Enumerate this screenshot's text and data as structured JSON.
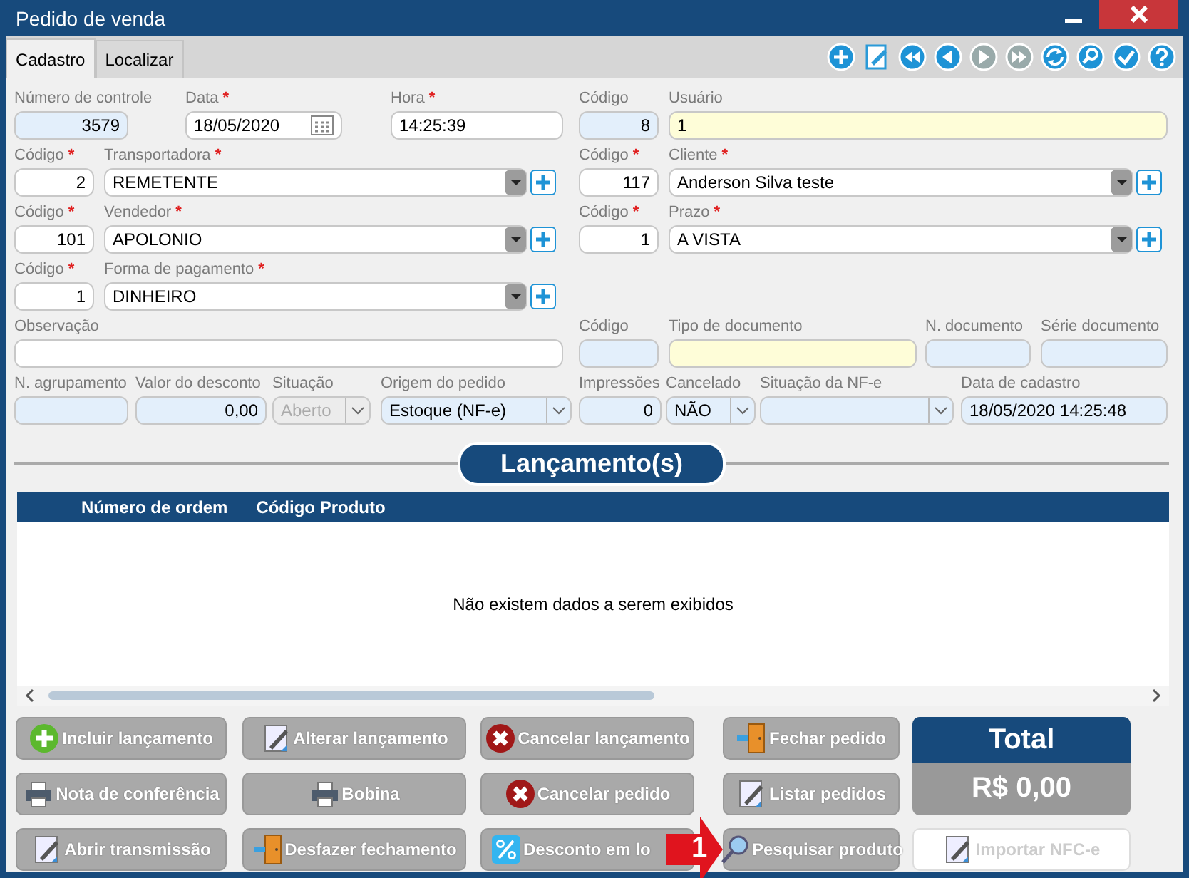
{
  "window": {
    "title": "Pedido de venda"
  },
  "tabs": [
    {
      "label": "Cadastro",
      "selected": true
    },
    {
      "label": "Localizar",
      "selected": false
    }
  ],
  "form_rows": [
    [
      {
        "label": "Número de controle",
        "kind": "readonly-number",
        "value": "3579"
      },
      {
        "label": "Data",
        "required_mark": "*",
        "kind": "date",
        "value": "18/05/2020"
      },
      {
        "label": "Hora",
        "required_mark": "*",
        "kind": "text",
        "value": "14:25:39"
      },
      {
        "label": "Código",
        "kind": "readonly-number",
        "value": "8"
      },
      {
        "label": "Usuário",
        "kind": "highlight",
        "value": "1"
      }
    ],
    [
      {
        "label": "Código",
        "required_mark": "*",
        "kind": "number",
        "value": "2"
      },
      {
        "label": "Transportadora",
        "required_mark": "*",
        "kind": "combo",
        "value": "REMETENTE"
      },
      {
        "label": "Código",
        "required_mark": "*",
        "kind": "number",
        "value": "117"
      },
      {
        "label": "Cliente",
        "required_mark": "*",
        "kind": "combo",
        "value": "Anderson Silva teste"
      }
    ],
    [
      {
        "label": "Código",
        "required_mark": "*",
        "kind": "number",
        "value": "101"
      },
      {
        "label": "Vendedor",
        "required_mark": "*",
        "kind": "combo",
        "value": "APOLONIO"
      },
      {
        "label": "Código",
        "required_mark": "*",
        "kind": "number",
        "value": "1"
      },
      {
        "label": "Prazo",
        "required_mark": "*",
        "kind": "combo",
        "value": "A VISTA"
      }
    ],
    [
      {
        "label": "Código",
        "required_mark": "*",
        "kind": "number",
        "value": "1"
      },
      {
        "label": "Forma de pagamento",
        "required_mark": "*",
        "kind": "combo",
        "value": "DINHEIRO"
      }
    ],
    [
      {
        "label": "Observação",
        "kind": "text"
      },
      {
        "label": "Código",
        "kind": "readonly"
      },
      {
        "label": "Tipo de documento",
        "kind": "highlight"
      },
      {
        "label": "N. documento",
        "kind": "readonly"
      },
      {
        "label": "Série documento",
        "kind": "readonly"
      }
    ],
    [
      {
        "label": "N. agrupamento",
        "kind": "readonly"
      },
      {
        "label": "Valor do desconto",
        "kind": "readonly-number",
        "value": "0,00"
      },
      {
        "label": "Situação",
        "kind": "select",
        "value": "Aberto",
        "disabled": true
      },
      {
        "label": "Origem do pedido",
        "kind": "select",
        "value": "Estoque (NF-e)",
        "disabled": false
      },
      {
        "label": "Impressões",
        "kind": "readonly-number",
        "value": "0"
      },
      {
        "label": "Cancelado",
        "kind": "select",
        "value": "NÃO",
        "disabled": false
      },
      {
        "label": "Situação da NF-e",
        "kind": "select",
        "disabled": false
      },
      {
        "label": "Data de cadastro",
        "kind": "readonly",
        "value": "18/05/2020 14:25:48"
      }
    ]
  ],
  "section_title": "Lançamento(s)",
  "table": {
    "columns": [
      "Número de ordem",
      "Código Produto"
    ],
    "empty_message": "Não existem dados a serem exibidos"
  },
  "buttons": [
    {
      "label": "Incluir lançamento",
      "kind": "plus",
      "disabled": false
    },
    {
      "label": "Alterar lançamento",
      "kind": "edit",
      "disabled": false
    },
    {
      "label": "Cancelar lançamento",
      "kind": "cancel",
      "disabled": false
    },
    {
      "label": "Fechar pedido",
      "kind": "door",
      "disabled": false
    },
    {
      "label": "Nota de conferência",
      "kind": "printer",
      "disabled": false
    },
    {
      "label": "Bobina",
      "kind": "printer",
      "disabled": false
    },
    {
      "label": "Cancelar pedido",
      "kind": "cancel",
      "disabled": false
    },
    {
      "label": "Listar pedidos",
      "kind": "edit",
      "disabled": false
    },
    {
      "label": "Abrir transmissão",
      "kind": "edit",
      "disabled": false
    },
    {
      "label": "Desfazer fechamento",
      "kind": "door",
      "disabled": false
    },
    {
      "label": "Desconto em lo",
      "kind": "percent",
      "disabled": false
    },
    {
      "label": "Pesquisar produto",
      "kind": "search",
      "disabled": false
    },
    {
      "label": "Importar NFC-e",
      "kind": "edit",
      "disabled": true
    }
  ],
  "total": {
    "title": "Total",
    "value": "R$ 0,00"
  },
  "annotation": "1"
}
